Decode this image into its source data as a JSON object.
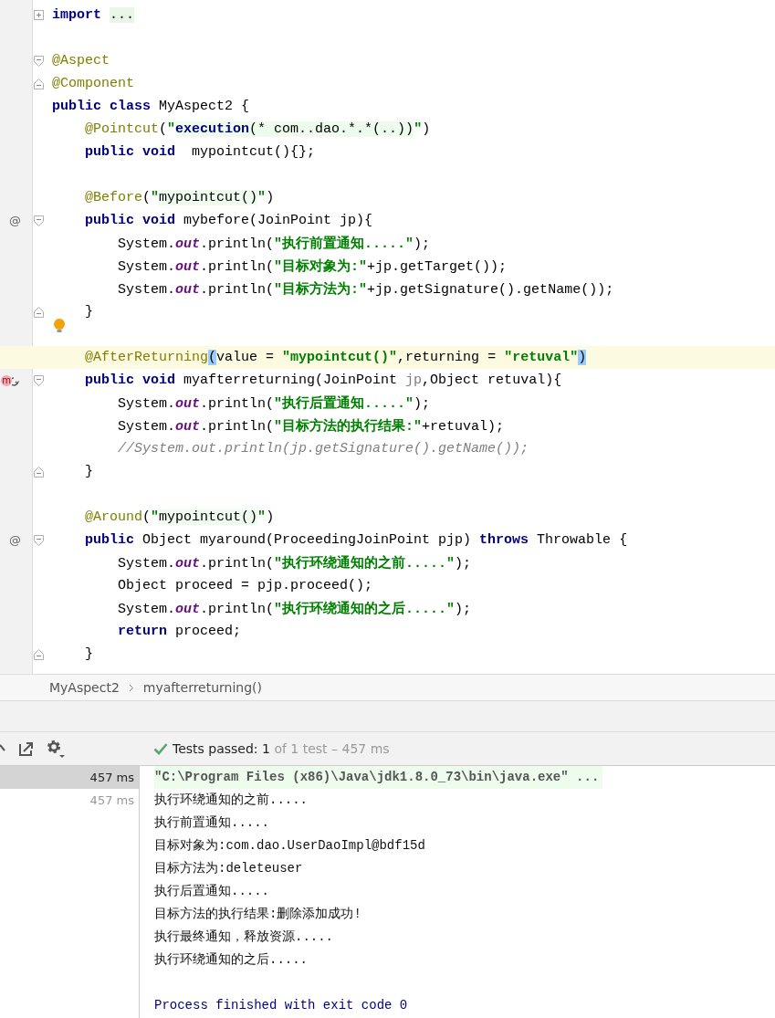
{
  "editor": {
    "lines": [
      {
        "gutter": [
          {
            "kind": "fold_plus"
          }
        ],
        "tokens": [
          {
            "kind": "kw",
            "t": "import "
          },
          {
            "kind": "folded",
            "t": "..."
          }
        ]
      },
      {
        "kind": "blank"
      },
      {
        "gutter": [
          {
            "kind": "fold_start"
          }
        ],
        "tokens": [
          {
            "kind": "ann",
            "t": "@Aspect"
          }
        ]
      },
      {
        "gutter": [
          {
            "kind": "fold_end"
          }
        ],
        "tokens": [
          {
            "kind": "ann",
            "t": "@Component"
          }
        ]
      },
      {
        "tokens": [
          {
            "kind": "kw",
            "t": "public class"
          },
          {
            "kind": "plain",
            "t": " MyAspect2 {"
          }
        ]
      },
      {
        "tokens": [
          {
            "kind": "ann",
            "t": "    @Pointcut"
          },
          {
            "kind": "plain",
            "t": "("
          },
          {
            "kind": "str",
            "t": "\""
          },
          {
            "kind": "injkw",
            "t": "execution"
          },
          {
            "kind": "inj",
            "t": "(* com..dao.*.*(..))"
          },
          {
            "kind": "str",
            "t": "\""
          },
          {
            "kind": "plain",
            "t": ")"
          }
        ]
      },
      {
        "tokens": [
          {
            "kind": "kw",
            "t": "    public void"
          },
          {
            "kind": "plain",
            "t": "  mypointcut(){};"
          }
        ]
      },
      {
        "kind": "blank"
      },
      {
        "tokens": [
          {
            "kind": "ann",
            "t": "    @Before"
          },
          {
            "kind": "plain",
            "t": "("
          },
          {
            "kind": "str",
            "t": "\""
          },
          {
            "kind": "inj",
            "t": "mypointcut()"
          },
          {
            "kind": "str",
            "t": "\""
          },
          {
            "kind": "plain",
            "t": ")"
          }
        ]
      },
      {
        "gutter": [
          {
            "kind": "at",
            "glyph": "@"
          },
          {
            "kind": "fold_start"
          }
        ],
        "tokens": [
          {
            "kind": "kw",
            "t": "    public void"
          },
          {
            "kind": "plain",
            "t": " mybefore(JoinPoint jp){"
          }
        ]
      },
      {
        "tokens": [
          {
            "kind": "plain",
            "t": "        System."
          },
          {
            "kind": "field",
            "t": "out"
          },
          {
            "kind": "plain",
            "t": ".println("
          },
          {
            "kind": "str",
            "t": "\"执行前置通知.....\""
          },
          {
            "kind": "plain",
            "t": ");"
          }
        ]
      },
      {
        "tokens": [
          {
            "kind": "plain",
            "t": "        System."
          },
          {
            "kind": "field",
            "t": "out"
          },
          {
            "kind": "plain",
            "t": ".println("
          },
          {
            "kind": "str",
            "t": "\"目标对象为:\""
          },
          {
            "kind": "plain",
            "t": "+jp.getTarget());"
          }
        ]
      },
      {
        "tokens": [
          {
            "kind": "plain",
            "t": "        System."
          },
          {
            "kind": "field",
            "t": "out"
          },
          {
            "kind": "plain",
            "t": ".println("
          },
          {
            "kind": "str",
            "t": "\"目标方法为:\""
          },
          {
            "kind": "plain",
            "t": "+jp.getSignature().getName());"
          }
        ]
      },
      {
        "gutter": [
          {
            "kind": "fold_end"
          }
        ],
        "tokens": [
          {
            "kind": "plain",
            "t": "    }"
          }
        ]
      },
      {
        "gutter": [
          {
            "kind": "bulb"
          }
        ]
      },
      {
        "current": true,
        "tokens": [
          {
            "kind": "ann",
            "t": "    @AfterReturning"
          },
          {
            "kind": "match",
            "t": "("
          },
          {
            "kind": "plain",
            "t": "value = "
          },
          {
            "kind": "str",
            "t": "\"mypointcut()\""
          },
          {
            "kind": "plain",
            "t": ",returning = "
          },
          {
            "kind": "str",
            "t": "\"retuval\""
          },
          {
            "kind": "match",
            "t": ")"
          }
        ]
      },
      {
        "current": false,
        "gutter": [
          {
            "kind": "override",
            "glyph": "m"
          },
          {
            "kind": "fold_start"
          }
        ],
        "tokens": [
          {
            "kind": "kw",
            "t": "    public void"
          },
          {
            "kind": "plain",
            "t": " myafterreturning(JoinPoint "
          },
          {
            "kind": "unused",
            "t": "jp"
          },
          {
            "kind": "plain",
            "t": ",Object retuval){"
          }
        ]
      },
      {
        "tokens": [
          {
            "kind": "plain",
            "t": "        System."
          },
          {
            "kind": "field",
            "t": "out"
          },
          {
            "kind": "plain",
            "t": ".println("
          },
          {
            "kind": "str",
            "t": "\"执行后置通知.....\""
          },
          {
            "kind": "plain",
            "t": ");"
          }
        ]
      },
      {
        "tokens": [
          {
            "kind": "plain",
            "t": "        System."
          },
          {
            "kind": "field",
            "t": "out"
          },
          {
            "kind": "plain",
            "t": ".println("
          },
          {
            "kind": "str",
            "t": "\"目标方法的执行结果:\""
          },
          {
            "kind": "plain",
            "t": "+retuval);"
          }
        ]
      },
      {
        "tokens": [
          {
            "kind": "comment",
            "t": "        //System.out.println(jp.getSignature().getName());"
          }
        ]
      },
      {
        "gutter": [
          {
            "kind": "fold_end"
          }
        ],
        "tokens": [
          {
            "kind": "plain",
            "t": "    }"
          }
        ]
      },
      {
        "kind": "blank"
      },
      {
        "tokens": [
          {
            "kind": "ann",
            "t": "    @Around"
          },
          {
            "kind": "plain",
            "t": "("
          },
          {
            "kind": "str",
            "t": "\""
          },
          {
            "kind": "inj",
            "t": "mypointcut()"
          },
          {
            "kind": "str",
            "t": "\""
          },
          {
            "kind": "plain",
            "t": ")"
          }
        ]
      },
      {
        "gutter": [
          {
            "kind": "at",
            "glyph": "@"
          },
          {
            "kind": "fold_start"
          }
        ],
        "tokens": [
          {
            "kind": "kw",
            "t": "    public"
          },
          {
            "kind": "plain",
            "t": " Object myaround(ProceedingJoinPoint pjp) "
          },
          {
            "kind": "kw",
            "t": "throws"
          },
          {
            "kind": "plain",
            "t": " Throwable {"
          }
        ]
      },
      {
        "tokens": [
          {
            "kind": "plain",
            "t": "        System."
          },
          {
            "kind": "field",
            "t": "out"
          },
          {
            "kind": "plain",
            "t": ".println("
          },
          {
            "kind": "str",
            "t": "\"执行环绕通知的之前.....\""
          },
          {
            "kind": "plain",
            "t": ");"
          }
        ]
      },
      {
        "tokens": [
          {
            "kind": "plain",
            "t": "        Object proceed = pjp.proceed();"
          }
        ]
      },
      {
        "tokens": [
          {
            "kind": "plain",
            "t": "        System."
          },
          {
            "kind": "field",
            "t": "out"
          },
          {
            "kind": "plain",
            "t": ".println("
          },
          {
            "kind": "str",
            "t": "\"执行环绕通知的之后.....\""
          },
          {
            "kind": "plain",
            "t": ");"
          }
        ]
      },
      {
        "tokens": [
          {
            "kind": "kw",
            "t": "        return"
          },
          {
            "kind": "plain",
            "t": " proceed;"
          }
        ]
      },
      {
        "gutter": [
          {
            "kind": "fold_end"
          }
        ],
        "tokens": [
          {
            "kind": "plain",
            "t": "    }"
          }
        ]
      }
    ]
  },
  "breadcrumb": [
    "MyAspect2",
    "myafterreturning()"
  ],
  "status": {
    "label": "Tests passed:",
    "count": "1",
    "detail": "of 1 test – 457 ms"
  },
  "tests": [
    {
      "duration": "457 ms",
      "selected": true
    },
    {
      "duration": "457 ms",
      "selected": false
    }
  ],
  "console": [
    {
      "kind": "cmd",
      "text": "\"C:\\Program Files (x86)\\Java\\jdk1.8.0_73\\bin\\java.exe\" ..."
    },
    {
      "kind": "out",
      "text": "执行环绕通知的之前....."
    },
    {
      "kind": "out",
      "text": "执行前置通知....."
    },
    {
      "kind": "out",
      "text": "目标对象为:com.dao.UserDaoImpl@bdf15d"
    },
    {
      "kind": "out",
      "text": "目标方法为:deleteuser"
    },
    {
      "kind": "out",
      "text": "执行后置通知....."
    },
    {
      "kind": "out",
      "text": "目标方法的执行结果:删除添加成功!"
    },
    {
      "kind": "out",
      "text": "执行最终通知，释放资源....."
    },
    {
      "kind": "out",
      "text": "执行环绕通知的之后....."
    },
    {
      "kind": "blank"
    },
    {
      "kind": "exit",
      "text": "Process finished with exit code 0"
    }
  ]
}
